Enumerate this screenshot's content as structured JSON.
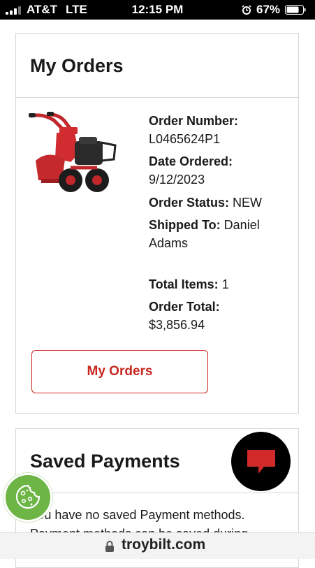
{
  "status_bar": {
    "carrier": "AT&T",
    "network": "LTE",
    "time": "12:15 PM",
    "battery_percent": "67%",
    "icons": [
      "signal-icon",
      "alarm-icon",
      "battery-icon"
    ]
  },
  "orders_card": {
    "title": "My Orders",
    "product_image": "tiller-product-image",
    "order_number_label": "Order Number:",
    "order_number": "L0465624P1",
    "date_label": "Date Ordered:",
    "date": "9/12/2023",
    "status_label": "Order Status:",
    "status": "NEW",
    "shipped_label": "Shipped To:",
    "shipped_to": "Daniel Adams",
    "items_label": "Total Items:",
    "items": "1",
    "total_label": "Order Total:",
    "total": "$3,856.94",
    "button_label": "My Orders"
  },
  "payments_card": {
    "title": "Saved Payments",
    "message": "You have no saved Payment methods. Payment methods can be saved during"
  },
  "url_bar": {
    "domain": "troybilt.com"
  },
  "colors": {
    "accent": "#c8261f",
    "cookie_button": "#6db544",
    "chat_button": "#000000"
  }
}
